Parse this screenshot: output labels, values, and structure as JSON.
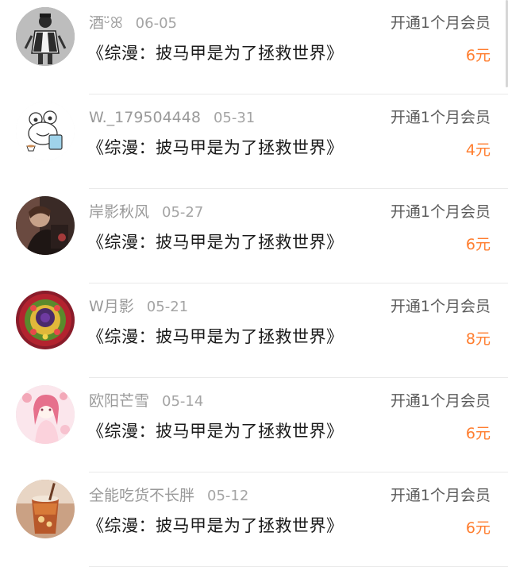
{
  "accent_color": "#ff7d2e",
  "records": [
    {
      "username": "酒ᵕ̈ꕤ",
      "date": "06-05",
      "book_title": "《综漫：披马甲是为了拯救世界》",
      "action": "开通1个月会员",
      "price": "6元",
      "avatar_icon": "avatar-sketch-figure"
    },
    {
      "username": "W._179504448",
      "date": "05-31",
      "book_title": "《综漫：披马甲是为了拯救世界》",
      "action": "开通1个月会员",
      "price": "4元",
      "avatar_icon": "avatar-cartoon-frog"
    },
    {
      "username": "岸影秋风",
      "date": "05-27",
      "book_title": "《综漫：披马甲是为了拯救世界》",
      "action": "开通1个月会员",
      "price": "6元",
      "avatar_icon": "avatar-dark-portrait"
    },
    {
      "username": "W月影",
      "date": "05-21",
      "book_title": "《综漫：披马甲是为了拯救世界》",
      "action": "开通1个月会员",
      "price": "8元",
      "avatar_icon": "avatar-fruit-cake"
    },
    {
      "username": "欧阳芒雪",
      "date": "05-14",
      "book_title": "《综漫：披马甲是为了拯救世界》",
      "action": "开通1个月会员",
      "price": "6元",
      "avatar_icon": "avatar-anime-girl"
    },
    {
      "username": "全能吃货不长胖",
      "date": "05-12",
      "book_title": "《综漫：披马甲是为了拯救世界》",
      "action": "开通1个月会员",
      "price": "6元",
      "avatar_icon": "avatar-drink-glass"
    }
  ]
}
